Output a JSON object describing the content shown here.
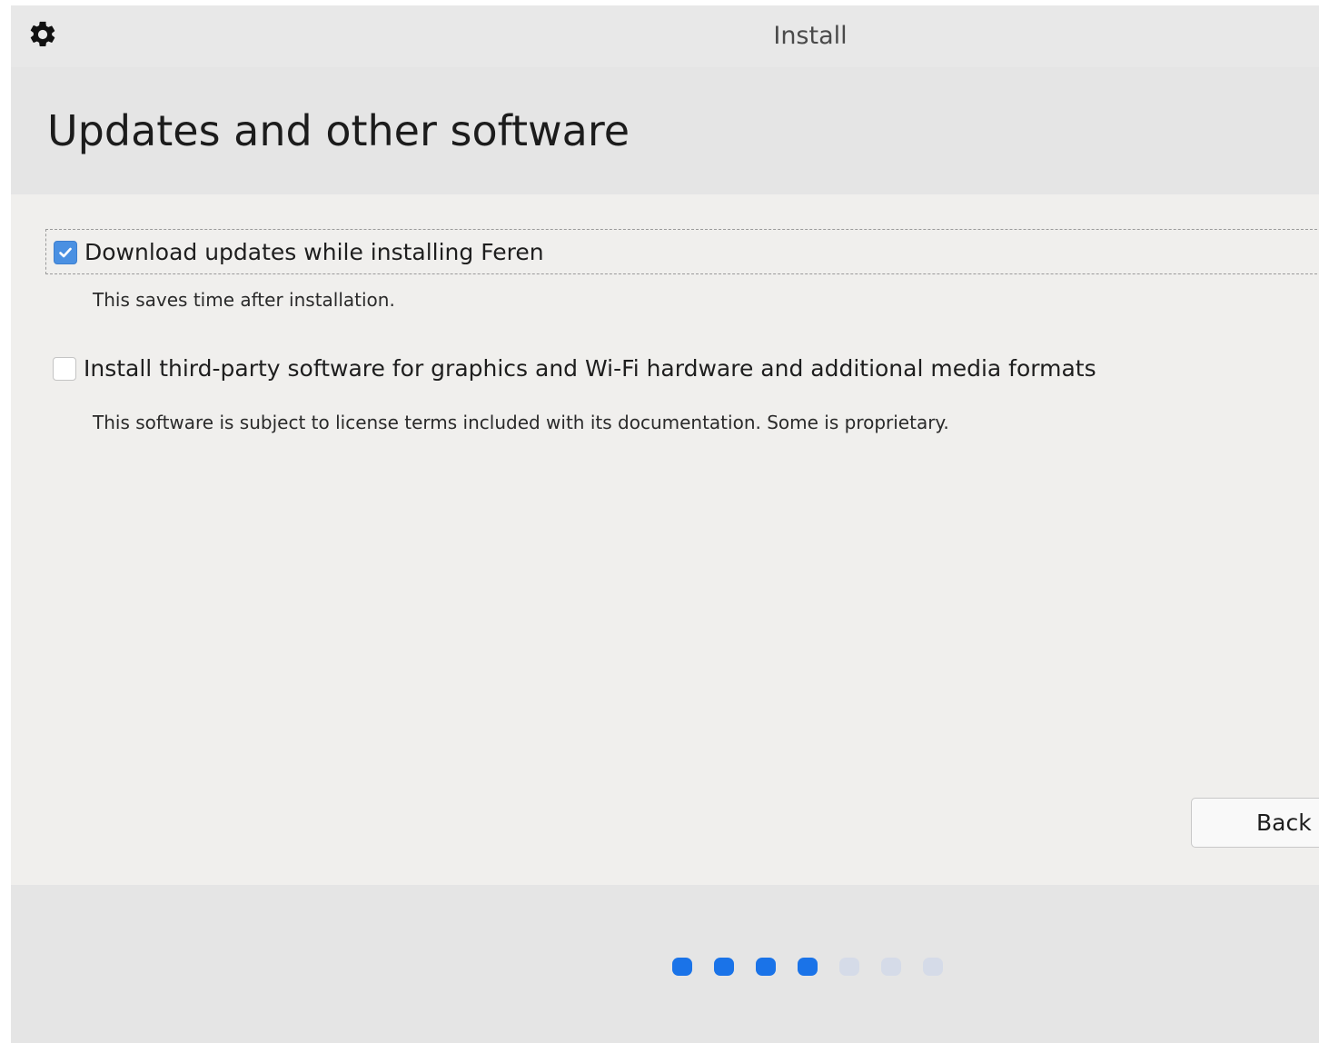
{
  "window": {
    "title": "Install",
    "settings_icon": "gear-icon"
  },
  "header": {
    "title": "Updates and other software"
  },
  "options": [
    {
      "label": "Download updates while installing Feren",
      "description": "This saves time after installation.",
      "checked": true
    },
    {
      "label": "Install third-party software for graphics and Wi-Fi hardware and additional media formats",
      "description": "This software is subject to license terms included with its documentation. Some is proprietary.",
      "checked": false
    }
  ],
  "buttons": {
    "back_label": "Back"
  },
  "progress": {
    "total_steps": 7,
    "completed_steps": 4,
    "active_color": "#1a73e8",
    "inactive_color": "#d5dbe8"
  },
  "colors": {
    "accent": "#4a90e2"
  }
}
